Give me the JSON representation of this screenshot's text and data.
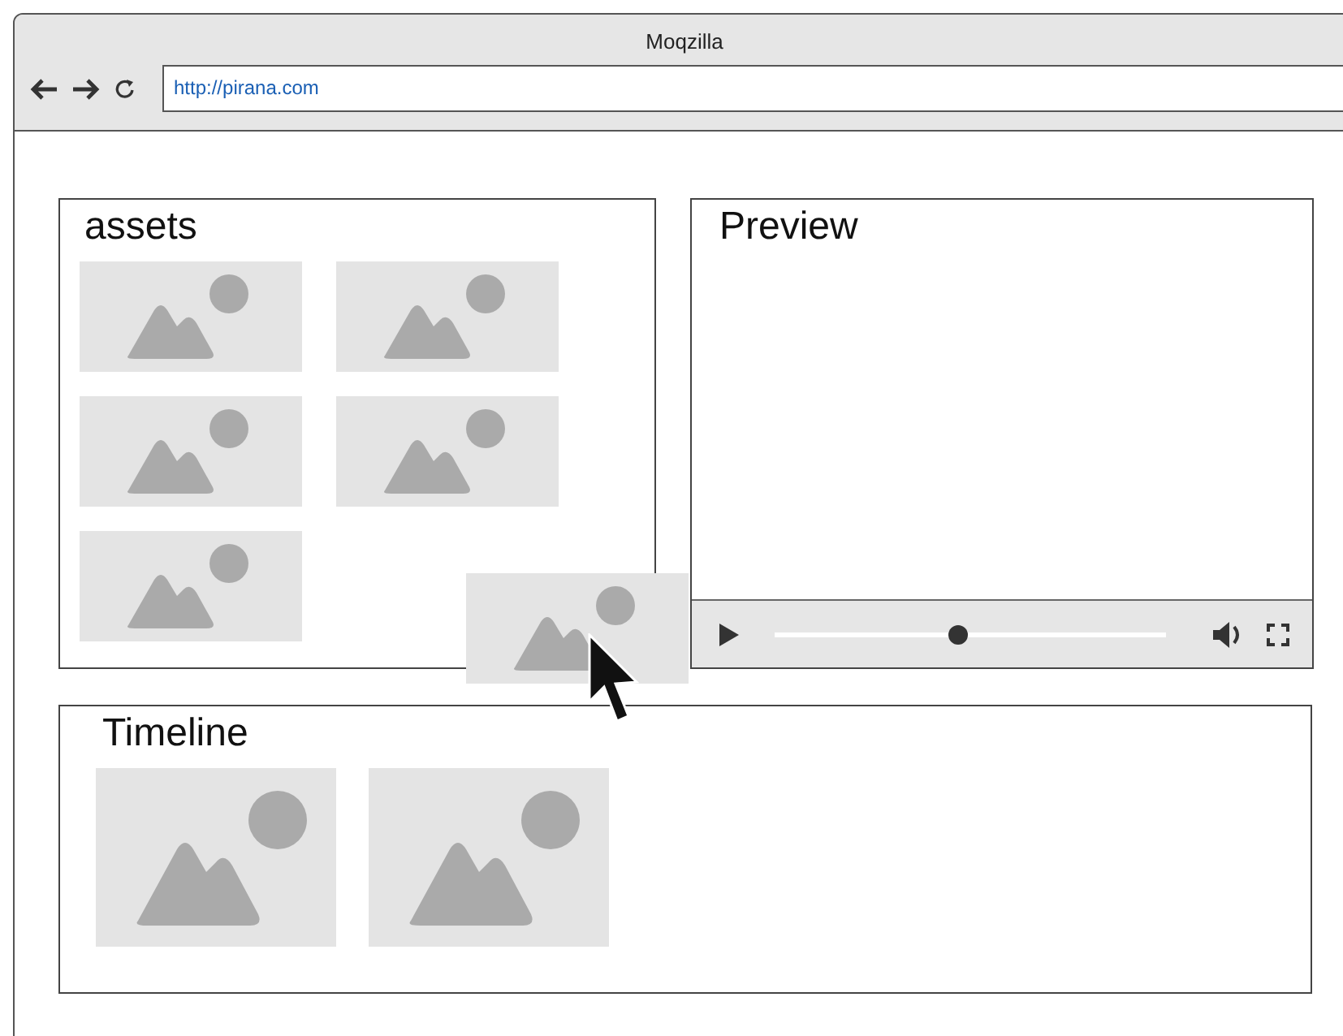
{
  "window": {
    "title": "Moqzilla"
  },
  "address_bar": {
    "value": "http://pirana.com"
  },
  "assets": {
    "title": "assets",
    "items": [
      {
        "kind": "image"
      },
      {
        "kind": "image"
      },
      {
        "kind": "image"
      },
      {
        "kind": "image"
      },
      {
        "kind": "image"
      }
    ]
  },
  "preview": {
    "title": "Preview",
    "player": {
      "level": 0.47
    }
  },
  "dragged_item": {
    "kind": "image"
  },
  "timeline": {
    "title": "Timeline",
    "items": [
      {
        "kind": "image"
      },
      {
        "kind": "image"
      }
    ]
  }
}
